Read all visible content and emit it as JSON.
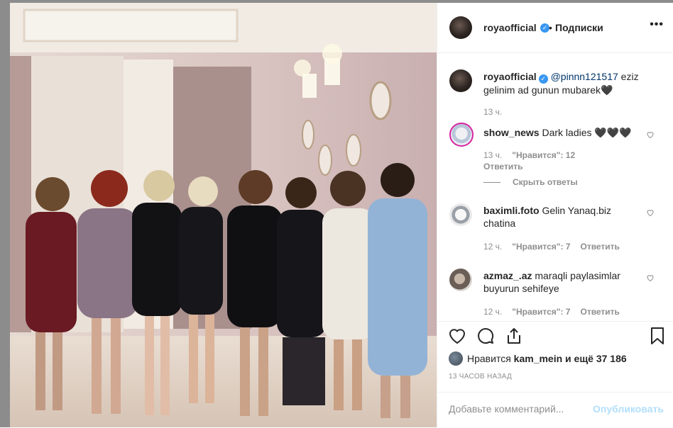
{
  "post": {
    "username": "royaofficial",
    "follow_label": "Подписки",
    "more_label": "•••",
    "dot": "•"
  },
  "caption": {
    "username": "royaofficial",
    "mention": "@pinnn121517",
    "text_line1_rest": " eziz",
    "text_line2": "gelinim ad gunun mubarek🖤",
    "time": "13 ч."
  },
  "comments": [
    {
      "username": "show_news",
      "text": " Dark ladies 🖤🖤🖤",
      "text2": "",
      "time": "13 ч.",
      "likes": "\"Нравится\": 12",
      "reply": "Ответить"
    },
    {
      "username": "baximli.foto",
      "text": " Gelin Yanaq.biz",
      "text2": "chatina",
      "time": "12 ч.",
      "likes": "\"Нравится\": 7",
      "reply": "Ответить"
    },
    {
      "username": "azmaz_.az",
      "text": " maraqli paylasimlar",
      "text2": "buyurun sehifeye",
      "time": "12 ч.",
      "likes": "\"Нравится\": 7",
      "reply": "Ответить"
    }
  ],
  "hide_replies": "Скрыть ответы",
  "likes": {
    "prefix": "Нравится ",
    "user": "kam_mein",
    "suffix": " и ещё 37 186"
  },
  "time_ago": "13 ЧАСОВ НАЗАД",
  "add_comment": {
    "placeholder": "Добавьте комментарий...",
    "publish": "Опубликовать"
  },
  "icons": [
    "heart-icon",
    "comment-icon",
    "share-icon",
    "bookmark-icon",
    "verified-badge-icon",
    "more-options-icon"
  ],
  "colors": {
    "accent": "#3897f0",
    "mention": "#003569",
    "muted": "#8e8e8e",
    "publish_disabled": "#b2dffc"
  }
}
